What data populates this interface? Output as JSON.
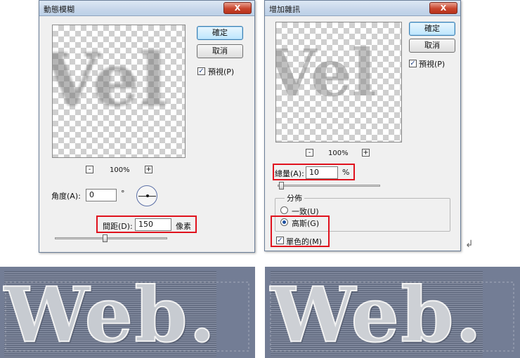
{
  "motion_blur_dialog": {
    "title": "動態模糊",
    "close_label": "X",
    "ok_label": "確定",
    "cancel_label": "取消",
    "preview_label": "預視(P)",
    "preview_checked": true,
    "preview_text": "Vel",
    "zoom_minus": "-",
    "zoom_value": "100%",
    "zoom_plus": "+",
    "angle_label": "角度(A):",
    "angle_value": "0",
    "angle_unit": "°",
    "distance_label": "間距(D):",
    "distance_value": "150",
    "distance_unit": "像素"
  },
  "add_noise_dialog": {
    "title": "增加雜訊",
    "close_label": "X",
    "ok_label": "確定",
    "cancel_label": "取消",
    "preview_label": "預視(P)",
    "preview_checked": true,
    "preview_text": "Vel",
    "zoom_minus": "-",
    "zoom_value": "100%",
    "zoom_plus": "+",
    "amount_label": "總量(A):",
    "amount_value": "10",
    "amount_unit": "%",
    "distribution_label": "分佈",
    "uniform_label": "一致(U)",
    "gaussian_label": "高斯(G)",
    "selected_distribution": "gaussian",
    "monochromatic_label": "單色的(M)",
    "monochromatic_checked": true
  },
  "results": {
    "left_text": "Web.",
    "right_text": "Web."
  },
  "colors": {
    "highlight": "#e0111d",
    "result_background": "#737d95"
  }
}
